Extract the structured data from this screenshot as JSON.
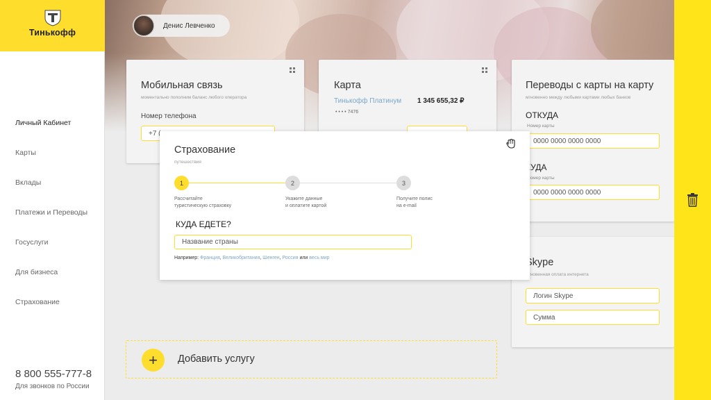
{
  "brand": {
    "logo_text": "Тинькофф"
  },
  "user": {
    "name": "Денис Левченко"
  },
  "sidebar": {
    "items": [
      {
        "label": "Личный Кабинет"
      },
      {
        "label": "Карты"
      },
      {
        "label": "Вклады"
      },
      {
        "label": "Платежи и Переводы"
      },
      {
        "label": "Госуслуги"
      },
      {
        "label": "Для бизнеса"
      },
      {
        "label": "Страхование"
      }
    ],
    "phone": "8 800 555-777-8",
    "phone_note": "Для звонков по России"
  },
  "mobile_card": {
    "title": "Мобильная связь",
    "subtitle": "моментально пополним баланс любого оператора",
    "phone_label": "Номер телефона",
    "phone_value": "+7 ("
  },
  "bank_card": {
    "title": "Карта",
    "card_name": "Тинькофф Платинум",
    "balance": "1 345 655,32 ₽",
    "masked_number": "• • • • 7476"
  },
  "transfer_card": {
    "title": "Переводы с карты на карту",
    "subtitle": "мгновенно между любыми картами любых банков",
    "from_heading": "ОТКУДА",
    "from_label": "Номер карты",
    "from_placeholder": "0000 0000 0000 0000",
    "to_heading": "КУДА",
    "to_label": "Номер карты",
    "to_placeholder": "0000 0000 0000 0000"
  },
  "skype_card": {
    "title": "Skype",
    "subtitle": "мгновенная оплата интернета",
    "login_placeholder": "Логин Skype",
    "amount_placeholder": "Сумма"
  },
  "insurance_modal": {
    "title": "Страхование",
    "subtitle": "путешествия",
    "steps": [
      {
        "number": "1",
        "line1": "Рассчитайте",
        "line2": "туристическую страховку"
      },
      {
        "number": "2",
        "line1": "Укажите данные",
        "line2": "и оплатите картой"
      },
      {
        "number": "3",
        "line1": "Получите полис",
        "line2": "на e-mail"
      }
    ],
    "question": "КУДА ЕДЕТЕ?",
    "country_placeholder": "Название страны",
    "example_prefix": "Например:",
    "examples": [
      "Франция",
      "Великобритания",
      "Шенген",
      "Россия"
    ],
    "example_or": "или",
    "example_world": "весь мир"
  },
  "add_service": {
    "label": "Добавить услугу",
    "plus": "+"
  },
  "colors": {
    "accent": "#ffdd2d",
    "right_bar": "#ffe41a",
    "link": "#7aa7cc"
  }
}
